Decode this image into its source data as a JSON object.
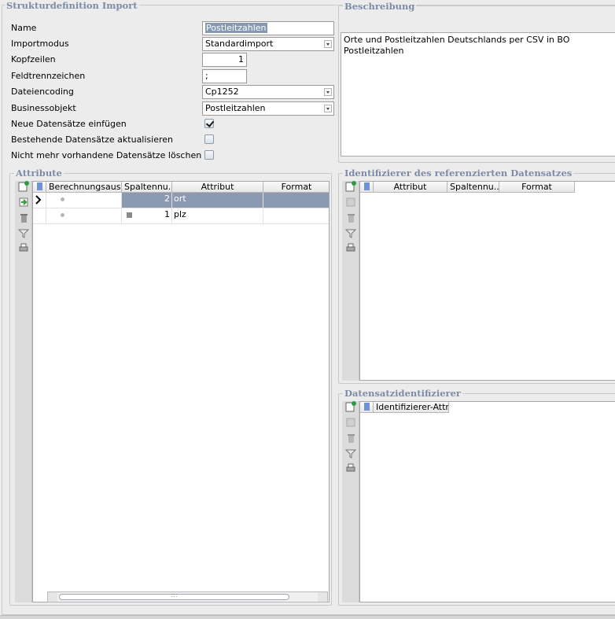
{
  "main_group": {
    "title": "Strukturdefinition Import"
  },
  "form": {
    "name_label": "Name",
    "name_value": "Postleitzahlen",
    "importmodus_label": "Importmodus",
    "importmodus_value": "Standardimport",
    "kopfzeilen_label": "Kopfzeilen",
    "kopfzeilen_value": "1",
    "feldtrenn_label": "Feldtrennzeichen",
    "feldtrenn_value": ";",
    "encoding_label": "Dateiencoding",
    "encoding_value": "Cp1252",
    "bo_label": "Businessobjekt",
    "bo_value": "Postleitzahlen",
    "neue_label": "Neue Datensätze einfügen",
    "neue_checked": true,
    "bestehende_label": "Bestehende Datensätze aktualisieren",
    "bestehende_checked": false,
    "loeschen_label": "Nicht mehr vorhandene Datensätze löschen",
    "loeschen_checked": false
  },
  "beschreibung": {
    "title": "Beschreibung",
    "text": "Orte und Postleitzahlen Deutschlands per CSV in BO Postleitzahlen"
  },
  "attribute": {
    "title": "Attribute",
    "columns": [
      "Berechnungsaus...",
      "Spaltennu...",
      "Attribut",
      "Format"
    ],
    "rows": [
      {
        "spalte": "2",
        "attribut": "ort",
        "format": ""
      },
      {
        "spalte": "1",
        "attribut": "plz",
        "format": ""
      }
    ],
    "scroll_grip": "III"
  },
  "identifizierer": {
    "title": "Identifizierer des referenzierten Datensatzes",
    "columns": [
      "Attribut",
      "Spaltennu...",
      "Format"
    ]
  },
  "datensatz": {
    "title": "Datensatzidentifizierer",
    "columns": [
      "Identifizierer-Attri..."
    ]
  }
}
